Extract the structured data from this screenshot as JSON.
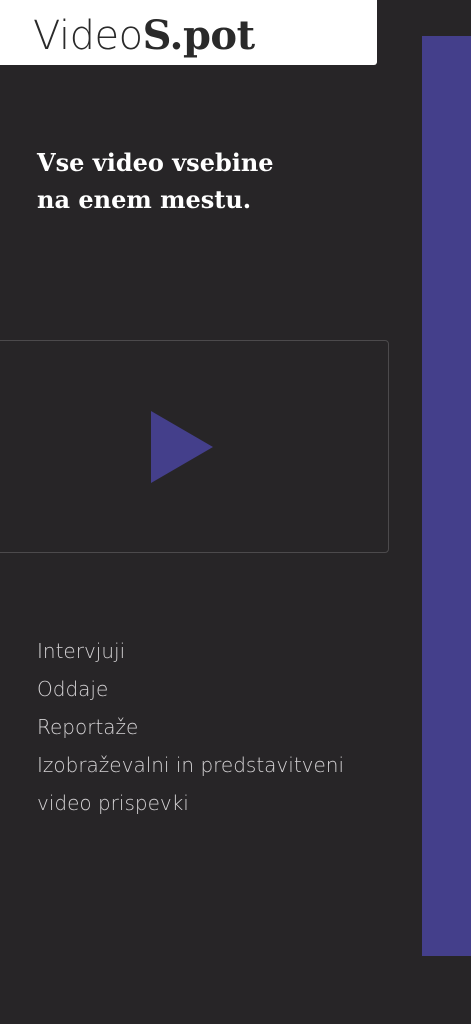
{
  "header": {
    "logo_light": "Video",
    "logo_bold": "S.pot"
  },
  "hero": {
    "headline_line1": "Vse video vsebine",
    "headline_line2": "na enem mestu."
  },
  "video": {
    "play_icon": "play-triangle-icon"
  },
  "categories": {
    "items": [
      {
        "label": "Intervjuji"
      },
      {
        "label": "Oddaje"
      },
      {
        "label": "Reportaže"
      },
      {
        "label": "Izobraževalni in predstavitveni"
      },
      {
        "label": "video prispevki"
      }
    ]
  },
  "colors": {
    "background": "#272527",
    "accent": "#443f8b",
    "header_bg": "#ffffff",
    "text_light": "#d4d2d4"
  }
}
